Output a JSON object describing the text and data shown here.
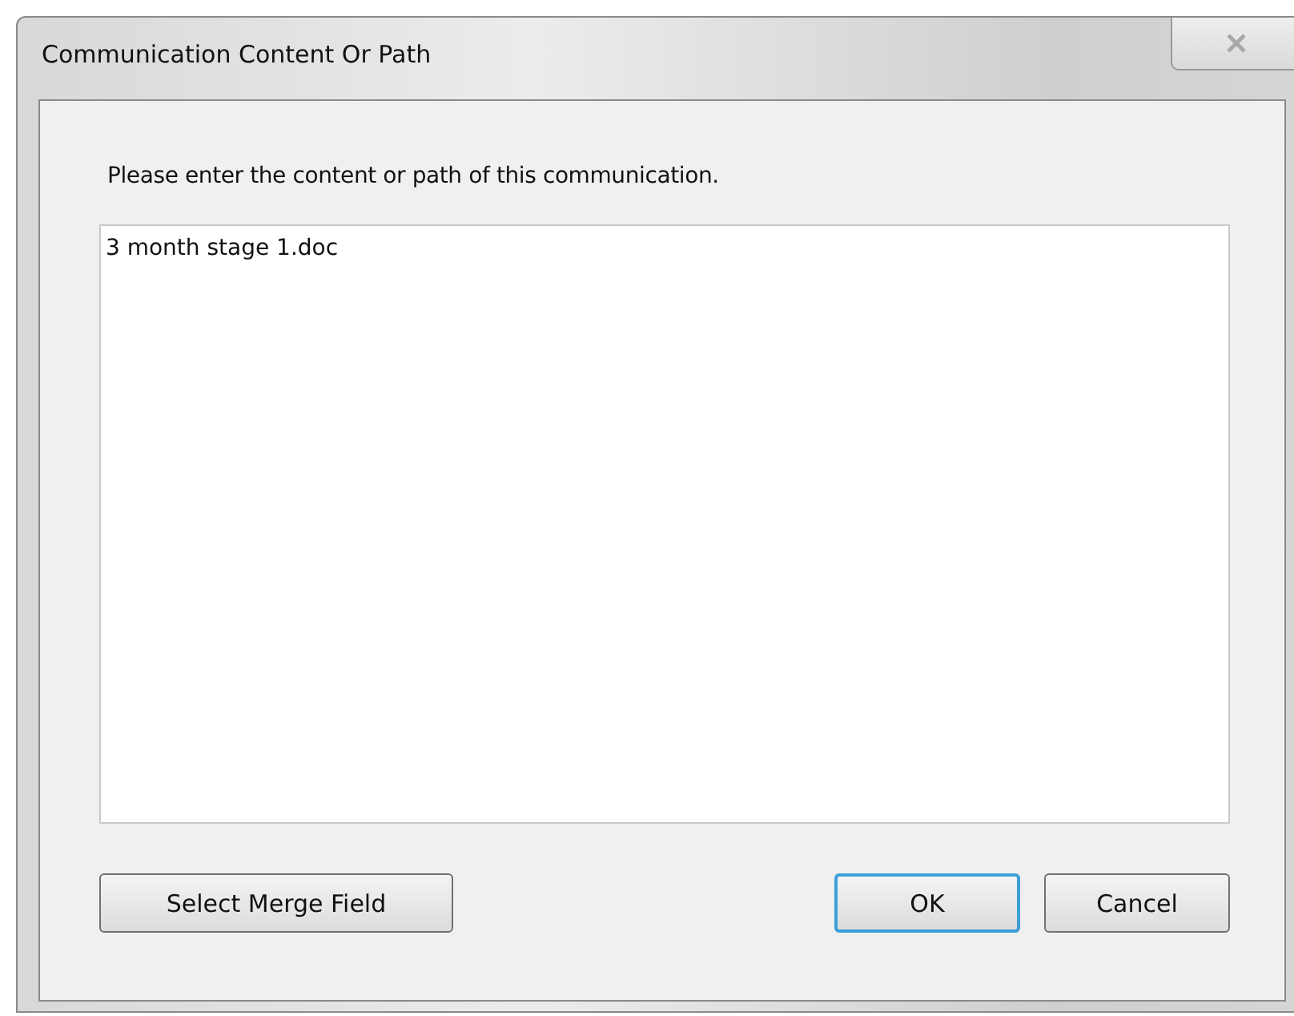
{
  "window": {
    "title": "Communication Content Or Path"
  },
  "prompt": "Please enter the content or path of this communication.",
  "content_field": {
    "value": "3 month stage 1.doc"
  },
  "buttons": [
    {
      "label": "Select Merge Field",
      "default": false,
      "kind": "left"
    },
    {
      "label": "OK",
      "default": true,
      "kind": "right"
    },
    {
      "label": "Cancel",
      "default": false,
      "kind": "right"
    }
  ]
}
